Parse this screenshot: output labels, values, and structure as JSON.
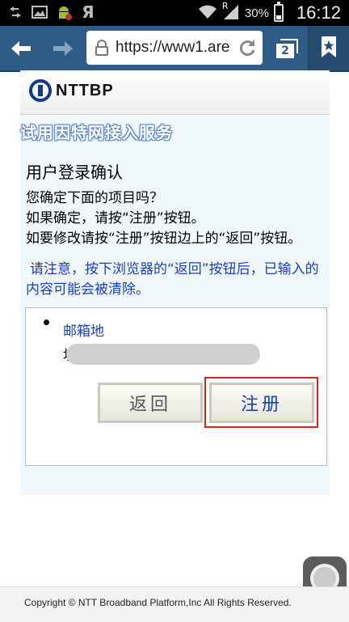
{
  "status_bar": {
    "battery_percent": "30%",
    "time": "16:12",
    "signal_badge": "R",
    "icons": [
      "usb-icon",
      "image-icon",
      "android-debug-icon",
      "app-icon",
      "wifi-icon",
      "signal-icon",
      "battery-icon"
    ]
  },
  "browser": {
    "url": "https://www1.are",
    "tab_count": "2"
  },
  "page": {
    "logo": "NTTBP",
    "service_title": "试用因特网接入服务",
    "section_title": "用户登录确认",
    "desc_line1": "您确定下面的项目吗？",
    "desc_line2": "如果确定，请按“注册”按钮。",
    "desc_line3": "如要修改请按“注册”按钮边上的“返回”按钮。",
    "warning": "请注意，按下浏览器的“返回”按钮后，已输入的内容可能会被清除。",
    "field_label_1": "邮箱地",
    "field_label_2": "址：",
    "back_button": "返回",
    "register_button": "注册"
  },
  "footer": {
    "copyright": "Copyright © NTT Broadband Platform,Inc All Rights Reserved."
  },
  "colors": {
    "toolbar": "#2f5c86",
    "link_blue": "#1a3fb8",
    "highlight_red": "#d9261c",
    "page_bg": "#f1f8fc"
  }
}
